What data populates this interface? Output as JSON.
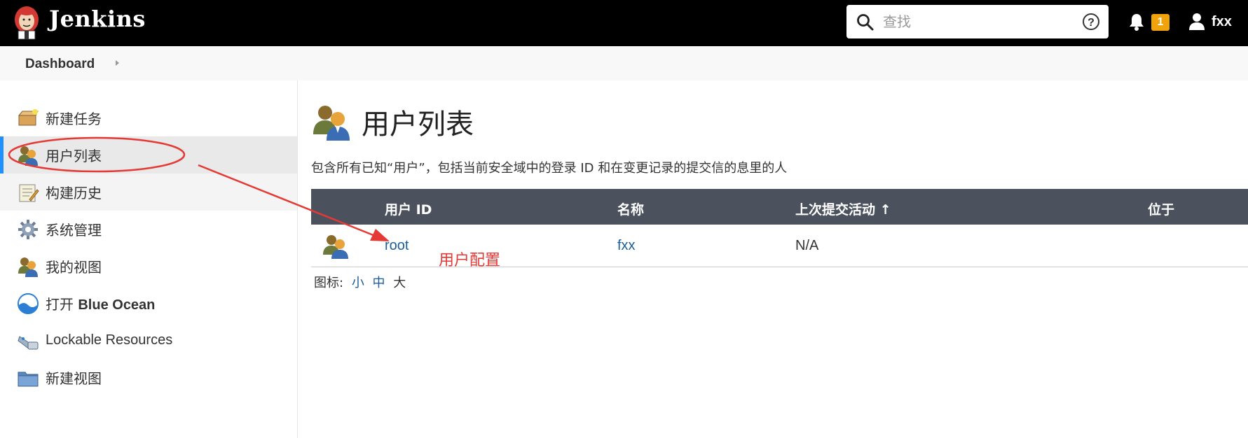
{
  "header": {
    "brand": "Jenkins",
    "search_placeholder": "查找",
    "notification_count": "1",
    "username": "fxx"
  },
  "breadcrumb": {
    "items": [
      "Dashboard"
    ]
  },
  "sidebar": {
    "items": [
      {
        "label": "新建任务",
        "icon": "new-task-icon"
      },
      {
        "label": "用户列表",
        "icon": "users-icon"
      },
      {
        "label": "构建历史",
        "icon": "notepad-icon"
      },
      {
        "label": "系统管理",
        "icon": "gear-icon"
      },
      {
        "label": "我的视图",
        "icon": "users-icon"
      },
      {
        "label_prefix": "打开 ",
        "label_bold": "Blue Ocean",
        "icon": "blue-ocean-icon"
      },
      {
        "label": "Lockable Resources",
        "icon": "lock-icon"
      },
      {
        "label": "新建视图",
        "icon": "folder-icon"
      }
    ]
  },
  "main": {
    "title": "用户列表",
    "description": "包含所有已知“用户”，包括当前安全域中的登录 ID 和在变更记录的提交信的息里的人",
    "table": {
      "columns": [
        "用户 ID",
        "名称",
        "上次提交活动 ↑",
        "位于"
      ],
      "rows": [
        {
          "user_id": "root",
          "name": "fxx",
          "last_commit": "N/A",
          "location": ""
        }
      ]
    },
    "icon_size": {
      "label": "图标:",
      "options": [
        "小",
        "中",
        "大"
      ],
      "selected": "大"
    }
  },
  "annotation": {
    "text": "用户配置",
    "color": "#e53935"
  },
  "colors": {
    "header_bg": "#000000",
    "table_header_bg": "#4b525e",
    "link": "#1a5f9b",
    "active_border": "#1e90ff",
    "badge": "#f0a30a"
  }
}
